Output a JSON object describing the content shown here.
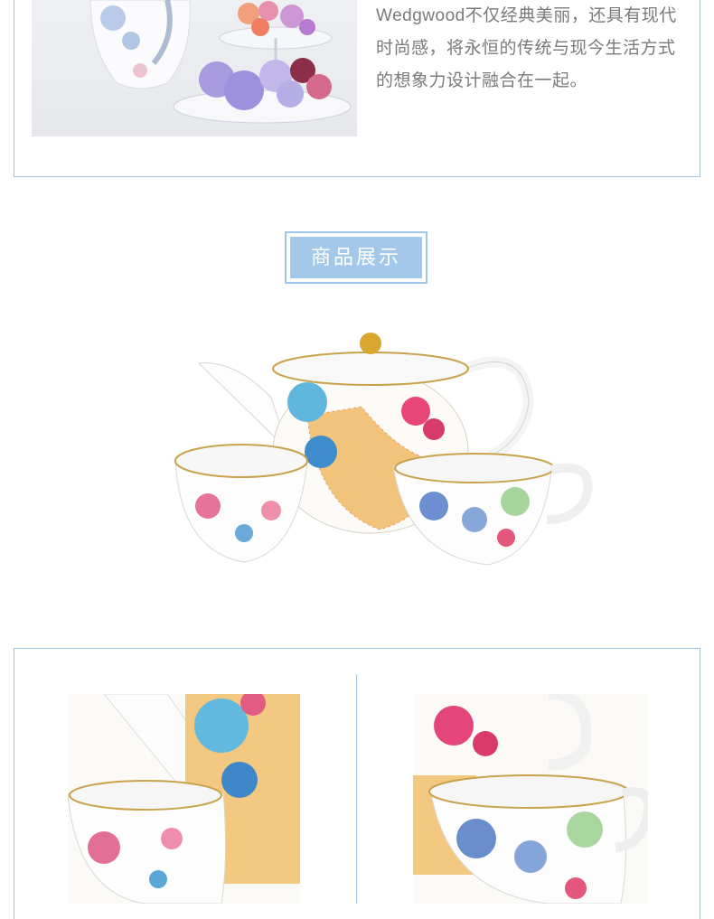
{
  "intro": {
    "description": "Wedgwood不仅经典美丽，还具有现代时尚感，将永恒的传统与现今生活方式的想象力设计融合在一起。"
  },
  "section": {
    "title": "商品展示"
  },
  "images": {
    "intro_photo": "tea-set-with-hydrangea-cake-stand",
    "product_photo": "butterfly-bloom-teapot-sugar-bowl-creamer",
    "detail_left": "teapot-and-sugar-bowl-closeup",
    "detail_right": "teapot-and-creamer-closeup"
  },
  "colors": {
    "border": "#9fc3da",
    "title_bg": "#a3c8ea",
    "text": "#7a7a7a"
  }
}
